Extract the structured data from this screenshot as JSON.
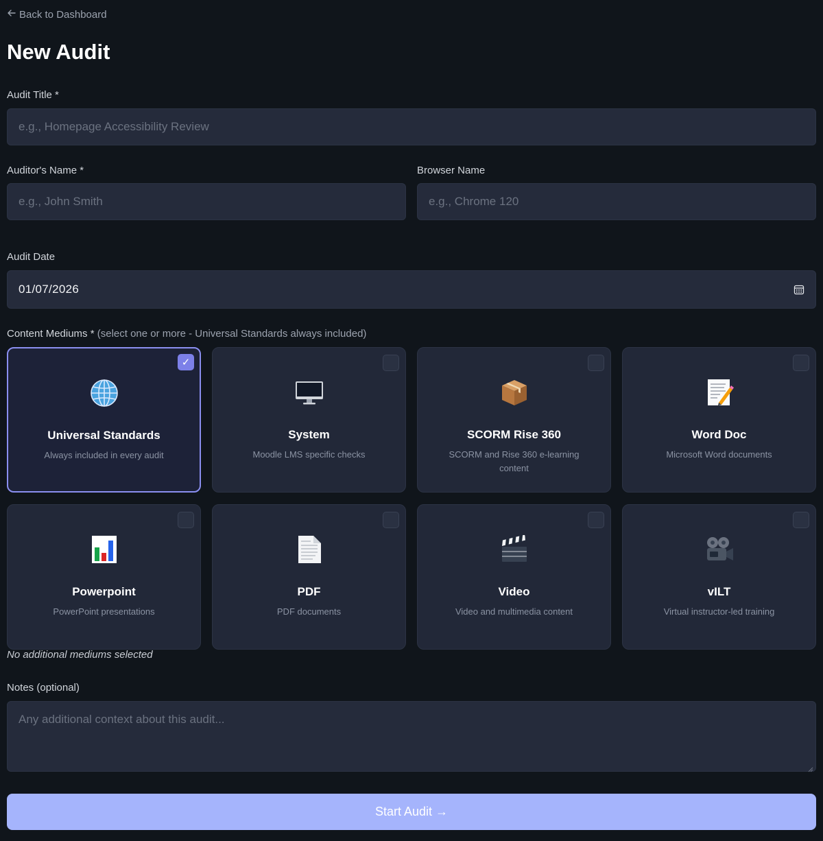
{
  "nav": {
    "back_label": "Back to Dashboard"
  },
  "page": {
    "title": "New Audit"
  },
  "form": {
    "audit_title": {
      "label": "Audit Title *",
      "placeholder": "e.g., Homepage Accessibility Review"
    },
    "auditor_name": {
      "label": "Auditor's Name *",
      "placeholder": "e.g., John Smith"
    },
    "browser_name": {
      "label": "Browser Name",
      "placeholder": "e.g., Chrome 120"
    },
    "audit_date": {
      "label": "Audit Date",
      "value": "01/07/2026"
    },
    "content_mediums": {
      "label": "Content Mediums *",
      "hint": "(select one or more - Universal Standards always included)",
      "items": [
        {
          "title": "Universal Standards",
          "description": "Always included in every audit",
          "icon": "globe-icon",
          "selected": true
        },
        {
          "title": "System",
          "description": "Moodle LMS specific checks",
          "icon": "computer-icon",
          "selected": false
        },
        {
          "title": "SCORM Rise 360",
          "description": "SCORM and Rise 360 e-learning content",
          "icon": "package-icon",
          "selected": false
        },
        {
          "title": "Word Doc",
          "description": "Microsoft Word documents",
          "icon": "memo-icon",
          "selected": false
        },
        {
          "title": "Powerpoint",
          "description": "PowerPoint presentations",
          "icon": "bar-chart-icon",
          "selected": false
        },
        {
          "title": "PDF",
          "description": "PDF documents",
          "icon": "page-icon",
          "selected": false
        },
        {
          "title": "Video",
          "description": "Video and multimedia content",
          "icon": "clapper-board-icon",
          "selected": false
        },
        {
          "title": "vILT",
          "description": "Virtual instructor-led training",
          "icon": "movie-camera-icon",
          "selected": false
        }
      ],
      "status": "No additional mediums selected"
    },
    "notes": {
      "label": "Notes (optional)",
      "placeholder": "Any additional context about this audit..."
    },
    "submit_label": "Start Audit →"
  },
  "colors": {
    "background": "#10151b",
    "field": "#252b3b",
    "accent": "#a5b4fc",
    "selected_border": "#8b8ff0",
    "checkbox_checked": "#7c80e8"
  }
}
